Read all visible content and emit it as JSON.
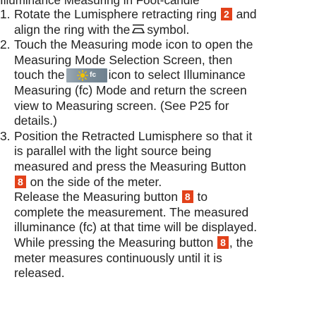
{
  "heading": "Illuminance Measuring in Foot-candle",
  "steps": [
    {
      "number": "1.",
      "line1_before": "Rotate the Lumisphere retracting ring",
      "line1_badge": "2",
      "line1_after": "and",
      "line2_before": "align the ring with the",
      "line2_after": "symbol.",
      "symbol_icon": "retracted-lumisphere-symbol"
    },
    {
      "number": "2.",
      "line1": "Touch the Measuring mode icon to open the",
      "line2": "Measuring Mode Selection Screen, then",
      "line3_before": "touch the",
      "line3_after": "icon to select Illuminance",
      "fc_icon_label": "fc",
      "line4": "Measuring (fc) Mode and return the screen",
      "line5": "view to Measuring screen. (See P25 for",
      "line6": "details.)"
    },
    {
      "number": "3.",
      "line1": "Position the Retracted Lumisphere so that it",
      "line2": "is parallel with the light source being",
      "line3": "measured and press the Measuring Button",
      "line4_badge": "8",
      "line4_after": "on the side of the meter.",
      "line5_before": "Release the Measuring button",
      "line5_badge": "8",
      "line5_after": "to",
      "line6": "complete the measurement. The measured",
      "line7": "illuminance (fc) at that time will be displayed.",
      "line8_before": "While pressing the Measuring button",
      "line8_badge": "8",
      "line8_after": ", the",
      "line9": "meter measures continuously until it is",
      "line10": "released."
    }
  ],
  "colors": {
    "badge": "#e2411a",
    "text": "#222222",
    "icon_bg": "#7d8e9b",
    "sun": "#f2c200"
  }
}
